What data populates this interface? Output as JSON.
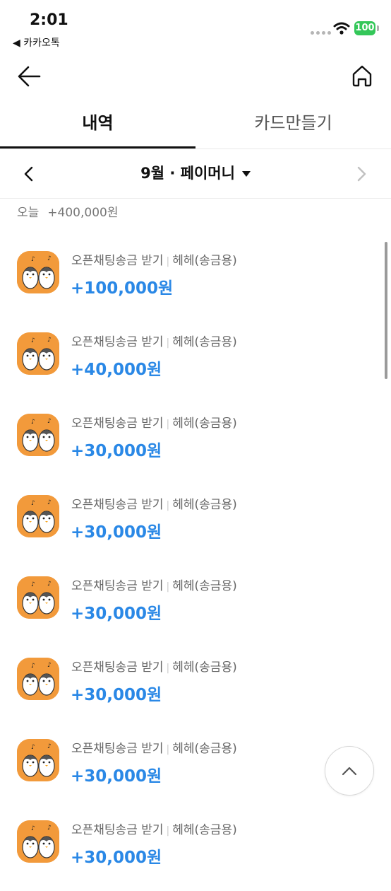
{
  "status_bar": {
    "time": "2:01",
    "back_app": "◀ 카카오톡",
    "battery": "100"
  },
  "tabs": [
    {
      "label": "내역",
      "active": true
    },
    {
      "label": "카드만들기",
      "active": false
    }
  ],
  "month_selector": {
    "label": "9월 · 페이머니"
  },
  "day_header": {
    "label": "오늘",
    "total": "+400,000원"
  },
  "transactions": [
    {
      "title": "오픈채팅송금 받기",
      "counterparty": "헤헤(송금용)",
      "amount": "+100,000원"
    },
    {
      "title": "오픈채팅송금 받기",
      "counterparty": "헤헤(송금용)",
      "amount": "+40,000원"
    },
    {
      "title": "오픈채팅송금 받기",
      "counterparty": "헤헤(송금용)",
      "amount": "+30,000원"
    },
    {
      "title": "오픈채팅송금 받기",
      "counterparty": "헤헤(송금용)",
      "amount": "+30,000원"
    },
    {
      "title": "오픈채팅송금 받기",
      "counterparty": "헤헤(송금용)",
      "amount": "+30,000원"
    },
    {
      "title": "오픈채팅송금 받기",
      "counterparty": "헤헤(송금용)",
      "amount": "+30,000원"
    },
    {
      "title": "오픈채팅송금 받기",
      "counterparty": "헤헤(송금용)",
      "amount": "+30,000원"
    },
    {
      "title": "오픈채팅송금 받기",
      "counterparty": "헤헤(송금용)",
      "amount": "+30,000원"
    }
  ],
  "colors": {
    "amount": "#2a88e6",
    "avatar_bg": "#f29a3b",
    "battery": "#34c759"
  },
  "icons": [
    "back-arrow-icon",
    "home-icon",
    "chevron-left-icon",
    "chevron-right-icon",
    "caret-down-icon",
    "chevron-up-icon",
    "wifi-icon"
  ]
}
